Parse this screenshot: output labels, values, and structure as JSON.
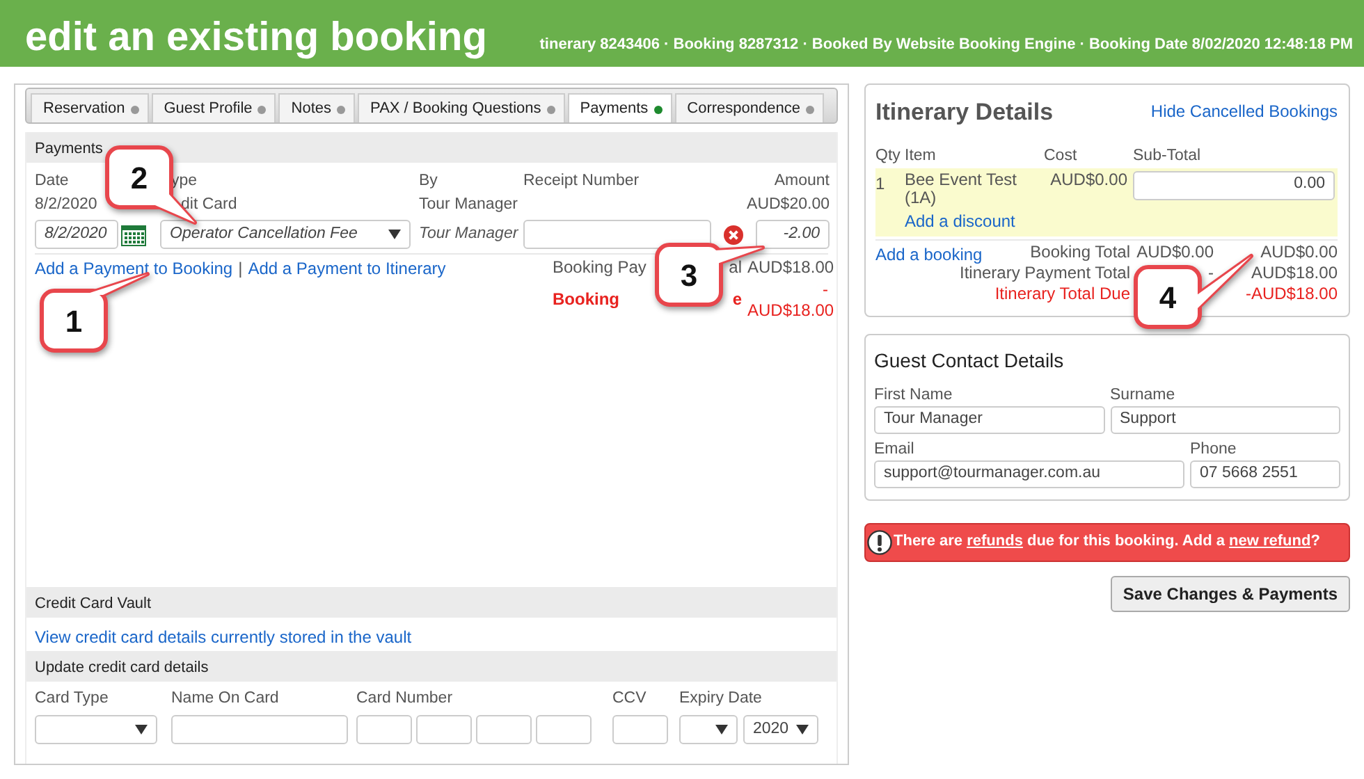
{
  "header": {
    "title": "edit an existing booking",
    "subtitle": "tinerary 8243406 · Booking 8287312 · Booked By Website Booking Engine · Booking Date 8/02/2020 12:48:18 PM"
  },
  "tabs": [
    {
      "label": "Reservation",
      "selected": false,
      "color": "#999999"
    },
    {
      "label": "Guest Profile",
      "selected": false,
      "color": "#999999"
    },
    {
      "label": "Notes",
      "selected": false,
      "color": "#999999"
    },
    {
      "label": "PAX / Booking Questions",
      "selected": false,
      "color": "#999999"
    },
    {
      "label": "Payments",
      "selected": true,
      "color": "#1e8a2e"
    },
    {
      "label": "Correspondence",
      "selected": false,
      "color": "#999999"
    }
  ],
  "payments": {
    "heading": "Payments",
    "columns": [
      "Date",
      "ype",
      "By",
      "Receipt Number",
      "Amount"
    ],
    "existing_row": {
      "date": "8/2/2020",
      "type": "dit Card",
      "by": "Tour Manager",
      "amount": "AUD$20.00"
    },
    "new_row": {
      "date": "8/2/2020",
      "type": "Operator Cancellation Fee",
      "by": "Tour Manager",
      "amount": "-2.00"
    },
    "links": [
      "Add a Payment to Booking",
      "Add a Payment to Itinerary"
    ],
    "link_separator": "|",
    "totals": [
      {
        "kind": "normal",
        "label_start": "Booking Pay",
        "label_end": "al",
        "value": "AUD$18.00"
      },
      {
        "kind": "due",
        "label_start": "Booking",
        "label_end": "e",
        "value": "- AUD$18.00"
      }
    ]
  },
  "vault": {
    "heading": "Credit Card Vault",
    "link": "View credit card details currently stored in the vault"
  },
  "card_update": {
    "heading": "Update credit card details",
    "labels": [
      "Card Type",
      "Name On Card",
      "Card Number",
      "CCV",
      "Expiry Date"
    ],
    "expiry_year": "2020"
  },
  "itinerary": {
    "title": "Itinerary Details",
    "link": "Hide Cancelled Bookings",
    "columns": [
      "Qty",
      "Item",
      "Cost",
      "Sub-Total"
    ],
    "items": [
      {
        "qty": "1",
        "item": "Bee Event Test (1A)",
        "cost": "AUD$0.00",
        "subtotal": "0.00",
        "discount_link": "Add a discount"
      }
    ],
    "add_link": "Add a booking",
    "totals": [
      {
        "kind": "normal",
        "label": "Booking Total",
        "cost": "AUD$0.00",
        "value": "AUD$0.00"
      },
      {
        "kind": "normal",
        "label": "Itinerary Payment Total",
        "cost": "-",
        "value": "AUD$18.00"
      },
      {
        "kind": "due",
        "label": "Itinerary Total Due",
        "value": "-AUD$18.00"
      }
    ]
  },
  "guest_contact": {
    "title": "Guest Contact Details",
    "fields": [
      {
        "label": "First Name",
        "value": "Tour Manager"
      },
      {
        "label": "Surname",
        "value": "Support"
      },
      {
        "label": "Email",
        "value": "support@tourmanager.com.au"
      },
      {
        "label": "Phone",
        "value": "07 5668 2551"
      }
    ]
  },
  "alert": {
    "parts": [
      {
        "text": "There are ",
        "link": false
      },
      {
        "text": "refunds",
        "link": true
      },
      {
        "text": " due for this booking. Add a ",
        "link": false
      },
      {
        "text": "new refund",
        "link": true
      },
      {
        "text": "?",
        "link": false
      }
    ]
  },
  "save_button": "Save Changes & Payments",
  "callouts": [
    {
      "number": "1"
    },
    {
      "number": "2"
    },
    {
      "number": "3"
    },
    {
      "number": "4"
    }
  ]
}
